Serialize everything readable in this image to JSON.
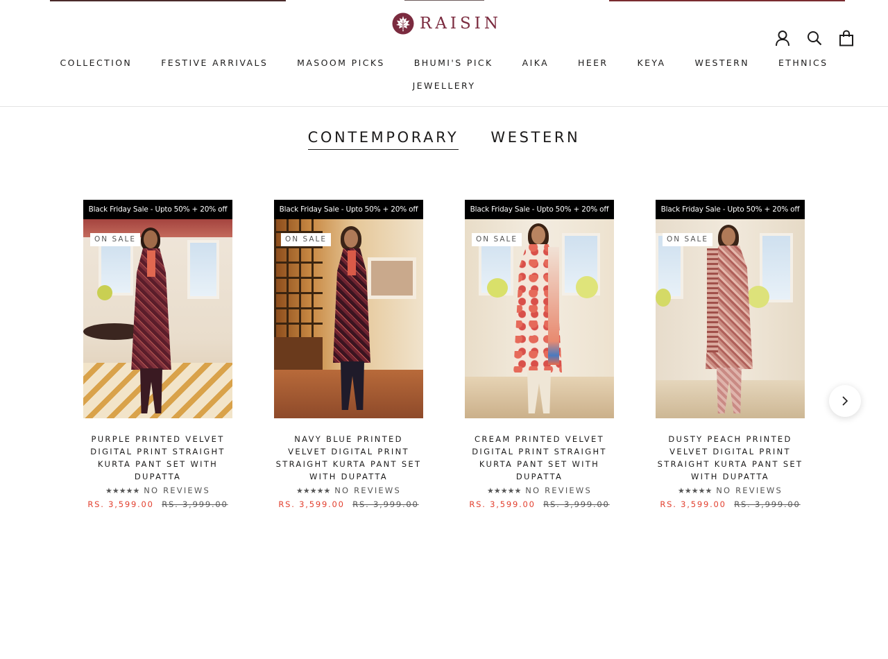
{
  "brand": {
    "name": "RAISIN",
    "color": "#7b2b3f"
  },
  "header": {
    "icons": [
      "account-icon",
      "search-icon",
      "cart-icon"
    ]
  },
  "nav": {
    "row1": [
      "COLLECTION",
      "FESTIVE ARRIVALS",
      "MASOOM PICKS",
      "BHUMI'S PICK",
      "AIKA",
      "HEER",
      "KEYA",
      "WESTERN",
      "ETHNICS"
    ],
    "row2": [
      "JEWELLERY"
    ]
  },
  "tabs": {
    "items": [
      "CONTEMPORARY",
      "WESTERN"
    ],
    "active": "CONTEMPORARY"
  },
  "products": [
    {
      "banner": "Black Friday Sale - Upto 50% + 20% off",
      "badge": "ON SALE",
      "title": "PURPLE PRINTED VELVET DIGITAL PRINT STRAIGHT KURTA PANT SET WITH DUPATTA",
      "stars": "★★★★★",
      "reviews": "NO REVIEWS",
      "price": "RS. 3,599.00",
      "compare_price": "RS. 3,999.00"
    },
    {
      "banner": "Black Friday Sale - Upto 50% + 20% off",
      "badge": "ON SALE",
      "title": "NAVY BLUE PRINTED VELVET DIGITAL PRINT STRAIGHT KURTA PANT SET WITH DUPATTA",
      "stars": "★★★★★",
      "reviews": "NO REVIEWS",
      "price": "RS. 3,599.00",
      "compare_price": "RS. 3,999.00"
    },
    {
      "banner": "Black Friday Sale - Upto 50% + 20% off",
      "badge": "ON SALE",
      "title": "CREAM PRINTED VELVET DIGITAL PRINT STRAIGHT KURTA PANT SET WITH DUPATTA",
      "stars": "★★★★★",
      "reviews": "NO REVIEWS",
      "price": "RS. 3,599.00",
      "compare_price": "RS. 3,999.00"
    },
    {
      "banner": "Black Friday Sale - Upto 50% + 20% off",
      "badge": "ON SALE",
      "title": "DUSTY PEACH PRINTED VELVET DIGITAL PRINT STRAIGHT KURTA PANT SET WITH DUPATTA",
      "stars": "★★★★★",
      "reviews": "NO REVIEWS",
      "price": "RS. 3,599.00",
      "compare_price": "RS. 3,999.00"
    }
  ],
  "colors": {
    "sale_price": "#e23e2d",
    "text": "#1c1b1b",
    "muted": "#555555"
  },
  "carousel": {
    "next_icon": "chevron-right-icon"
  }
}
